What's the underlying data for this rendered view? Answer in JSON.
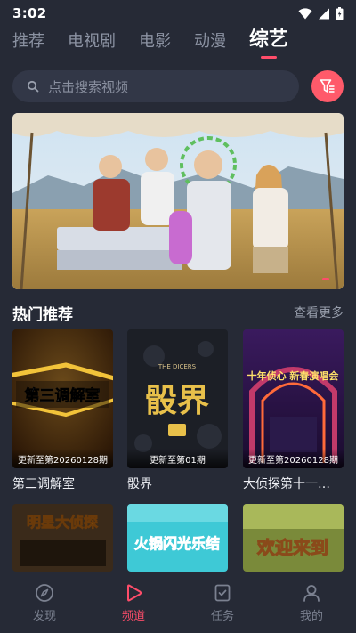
{
  "status_bar": {
    "time": "3:02"
  },
  "top_tabs": [
    {
      "label": "推荐",
      "active": false
    },
    {
      "label": "电视剧",
      "active": false
    },
    {
      "label": "电影",
      "active": false
    },
    {
      "label": "动漫",
      "active": false
    },
    {
      "label": "综艺",
      "active": true
    }
  ],
  "search": {
    "placeholder": "点击搜索视频"
  },
  "section": {
    "title": "热门推荐",
    "more_label": "查看更多"
  },
  "cards": [
    {
      "title": "第三调解室",
      "caption": "更新至第20260128期",
      "poster_text": "第三调解室"
    },
    {
      "title": "骰界",
      "caption": "更新至第01期",
      "poster_text": "骰界",
      "poster_sub": "THE DICERS"
    },
    {
      "title": "大侦探第十一…",
      "caption": "更新至第20260128期",
      "poster_text": "十年侦心 新春演唱会"
    }
  ],
  "row2_posters": [
    {
      "poster_text": "明星大侦探"
    },
    {
      "poster_text": "火锅闪光乐结"
    },
    {
      "poster_text": "欢迎来到"
    }
  ],
  "bottom_nav": [
    {
      "label": "发现",
      "icon": "compass-icon",
      "active": false
    },
    {
      "label": "频道",
      "icon": "play-icon",
      "active": true
    },
    {
      "label": "任务",
      "icon": "task-icon",
      "active": false
    },
    {
      "label": "我的",
      "icon": "profile-icon",
      "active": false
    }
  ],
  "colors": {
    "accent": "#ff4d6a",
    "background": "#262a36",
    "search_bg": "#323747"
  }
}
